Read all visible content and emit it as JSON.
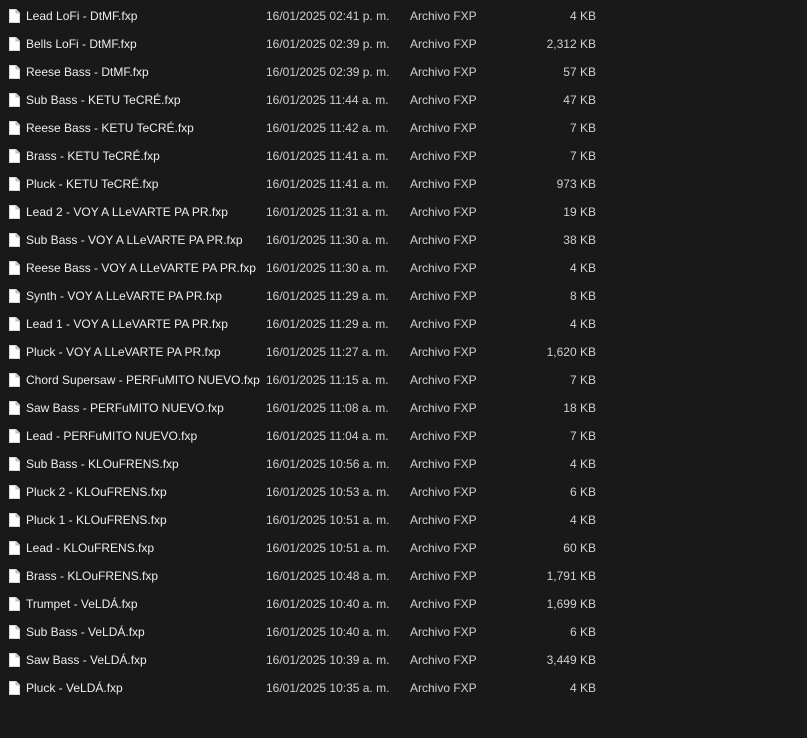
{
  "files": [
    {
      "name": "Lead LoFi - DtMF.fxp",
      "date": "16/01/2025 02:41 p. m.",
      "type": "Archivo FXP",
      "size": "4 KB",
      "icon": "file-icon"
    },
    {
      "name": "Bells LoFi - DtMF.fxp",
      "date": "16/01/2025 02:39 p. m.",
      "type": "Archivo FXP",
      "size": "2,312 KB",
      "icon": "file-icon"
    },
    {
      "name": "Reese Bass - DtMF.fxp",
      "date": "16/01/2025 02:39 p. m.",
      "type": "Archivo FXP",
      "size": "57 KB",
      "icon": "file-icon"
    },
    {
      "name": "Sub Bass - KETU TeCRÉ.fxp",
      "date": "16/01/2025 11:44 a. m.",
      "type": "Archivo FXP",
      "size": "47 KB",
      "icon": "file-icon"
    },
    {
      "name": "Reese Bass - KETU TeCRÉ.fxp",
      "date": "16/01/2025 11:42 a. m.",
      "type": "Archivo FXP",
      "size": "7 KB",
      "icon": "file-icon"
    },
    {
      "name": "Brass - KETU TeCRÉ.fxp",
      "date": "16/01/2025 11:41 a. m.",
      "type": "Archivo FXP",
      "size": "7 KB",
      "icon": "file-icon"
    },
    {
      "name": "Pluck - KETU TeCRÉ.fxp",
      "date": "16/01/2025 11:41 a. m.",
      "type": "Archivo FXP",
      "size": "973 KB",
      "icon": "file-icon"
    },
    {
      "name": "Lead 2 - VOY A LLeVARTE PA PR.fxp",
      "date": "16/01/2025 11:31 a. m.",
      "type": "Archivo FXP",
      "size": "19 KB",
      "icon": "file-icon"
    },
    {
      "name": "Sub Bass - VOY A LLeVARTE PA PR.fxp",
      "date": "16/01/2025 11:30 a. m.",
      "type": "Archivo FXP",
      "size": "38 KB",
      "icon": "file-icon"
    },
    {
      "name": "Reese Bass - VOY A LLeVARTE PA PR.fxp",
      "date": "16/01/2025 11:30 a. m.",
      "type": "Archivo FXP",
      "size": "4 KB",
      "icon": "file-icon"
    },
    {
      "name": "Synth - VOY A LLeVARTE PA PR.fxp",
      "date": "16/01/2025 11:29 a. m.",
      "type": "Archivo FXP",
      "size": "8 KB",
      "icon": "file-icon"
    },
    {
      "name": "Lead 1 - VOY A LLeVARTE PA PR.fxp",
      "date": "16/01/2025 11:29 a. m.",
      "type": "Archivo FXP",
      "size": "4 KB",
      "icon": "file-icon"
    },
    {
      "name": "Pluck - VOY A LLeVARTE PA PR.fxp",
      "date": "16/01/2025 11:27 a. m.",
      "type": "Archivo FXP",
      "size": "1,620 KB",
      "icon": "file-icon"
    },
    {
      "name": "Chord Supersaw - PERFuMITO NUEVO.fxp",
      "date": "16/01/2025 11:15 a. m.",
      "type": "Archivo FXP",
      "size": "7 KB",
      "icon": "file-icon"
    },
    {
      "name": "Saw Bass - PERFuMITO NUEVO.fxp",
      "date": "16/01/2025 11:08 a. m.",
      "type": "Archivo FXP",
      "size": "18 KB",
      "icon": "file-icon"
    },
    {
      "name": "Lead - PERFuMITO NUEVO.fxp",
      "date": "16/01/2025 11:04 a. m.",
      "type": "Archivo FXP",
      "size": "7 KB",
      "icon": "file-icon"
    },
    {
      "name": "Sub Bass - KLOuFRENS.fxp",
      "date": "16/01/2025 10:56 a. m.",
      "type": "Archivo FXP",
      "size": "4 KB",
      "icon": "file-icon"
    },
    {
      "name": "Pluck 2 - KLOuFRENS.fxp",
      "date": "16/01/2025 10:53 a. m.",
      "type": "Archivo FXP",
      "size": "6 KB",
      "icon": "file-icon"
    },
    {
      "name": "Pluck 1 - KLOuFRENS.fxp",
      "date": "16/01/2025 10:51 a. m.",
      "type": "Archivo FXP",
      "size": "4 KB",
      "icon": "file-icon"
    },
    {
      "name": "Lead - KLOuFRENS.fxp",
      "date": "16/01/2025 10:51 a. m.",
      "type": "Archivo FXP",
      "size": "60 KB",
      "icon": "file-icon"
    },
    {
      "name": "Brass - KLOuFRENS.fxp",
      "date": "16/01/2025 10:48 a. m.",
      "type": "Archivo FXP",
      "size": "1,791 KB",
      "icon": "file-icon"
    },
    {
      "name": "Trumpet - VeLDÁ.fxp",
      "date": "16/01/2025 10:40 a. m.",
      "type": "Archivo FXP",
      "size": "1,699 KB",
      "icon": "file-icon"
    },
    {
      "name": "Sub Bass - VeLDÁ.fxp",
      "date": "16/01/2025 10:40 a. m.",
      "type": "Archivo FXP",
      "size": "6 KB",
      "icon": "file-icon"
    },
    {
      "name": "Saw Bass - VeLDÁ.fxp",
      "date": "16/01/2025 10:39 a. m.",
      "type": "Archivo FXP",
      "size": "3,449 KB",
      "icon": "file-icon"
    },
    {
      "name": "Pluck - VeLDÁ.fxp",
      "date": "16/01/2025 10:35 a. m.",
      "type": "Archivo FXP",
      "size": "4 KB",
      "icon": "file-icon"
    }
  ],
  "colors": {
    "background": "#191919",
    "text": "#e6e6e6",
    "icon_fill": "#ffffff"
  }
}
